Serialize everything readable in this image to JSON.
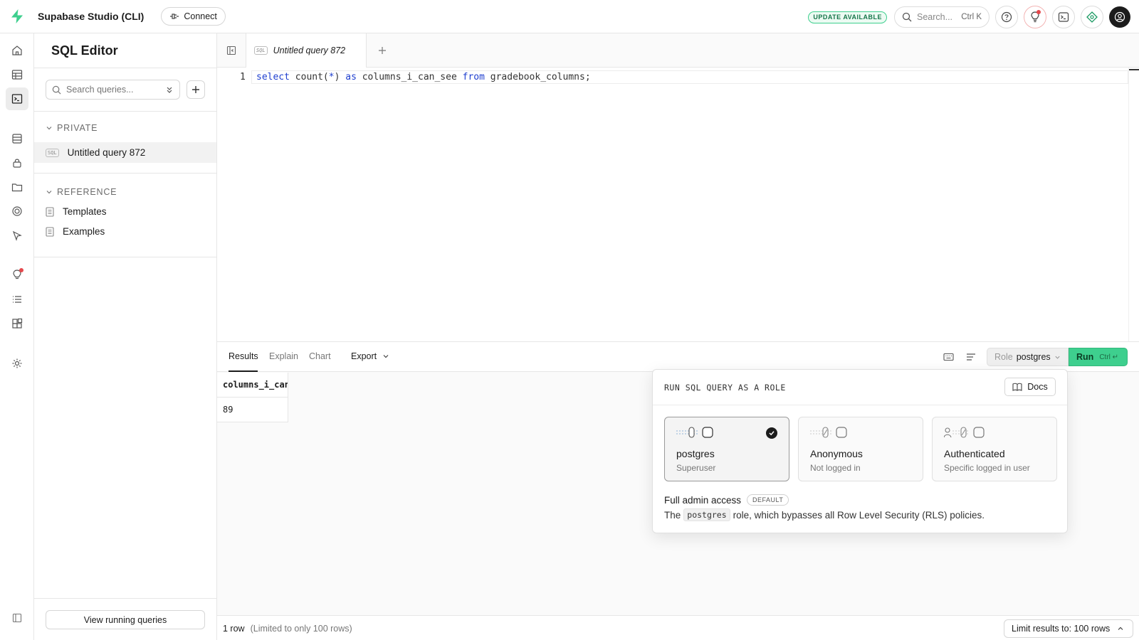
{
  "topbar": {
    "app_title": "Supabase Studio (CLI)",
    "connect_label": "Connect",
    "update_badge": "UPDATE AVAILABLE",
    "search_placeholder": "Search...",
    "search_shortcut": "Ctrl K"
  },
  "sidebar": {
    "title": "SQL Editor",
    "search_placeholder": "Search queries...",
    "private_label": "PRIVATE",
    "private_items": [
      {
        "tag": "SQL",
        "label": "Untitled query 872"
      }
    ],
    "reference_label": "REFERENCE",
    "reference_items": [
      {
        "label": "Templates"
      },
      {
        "label": "Examples"
      }
    ],
    "running_label": "View running queries"
  },
  "editor": {
    "tab_tag": "SQL",
    "tab_label": "Untitled query 872",
    "line_number": "1",
    "code": {
      "kw_select": "select",
      "fn": " count(",
      "star": "*",
      "fn_close": ") ",
      "kw_as": "as",
      "alias": " columns_i_can_see ",
      "kw_from": "from",
      "table": " gradebook_columns;"
    }
  },
  "results": {
    "tabs": [
      "Results",
      "Explain",
      "Chart"
    ],
    "export_label": "Export",
    "role_label": "Role",
    "role_value": "postgres",
    "run_label": "Run",
    "run_shortcut": "Ctrl ↵",
    "column_header": "columns_i_can_see",
    "cell_value": "89",
    "footer_rows": "1 row",
    "footer_limit_note": "(Limited to only 100 rows)",
    "limit_label": "Limit results to: 100 rows"
  },
  "popover": {
    "title": "RUN SQL QUERY AS A ROLE",
    "docs_label": "Docs",
    "roles": [
      {
        "name": "postgres",
        "sub": "Superuser"
      },
      {
        "name": "Anonymous",
        "sub": "Not logged in"
      },
      {
        "name": "Authenticated",
        "sub": "Specific logged in user"
      }
    ],
    "desc_title": "Full admin access",
    "default_badge": "DEFAULT",
    "desc_prefix": "The",
    "desc_code": "postgres",
    "desc_suffix": "role, which bypasses all Row Level Security (RLS) policies."
  },
  "colors": {
    "accent": "#3ecf8e",
    "keyword": "#1f3fcf",
    "alert": "#e5484d"
  }
}
